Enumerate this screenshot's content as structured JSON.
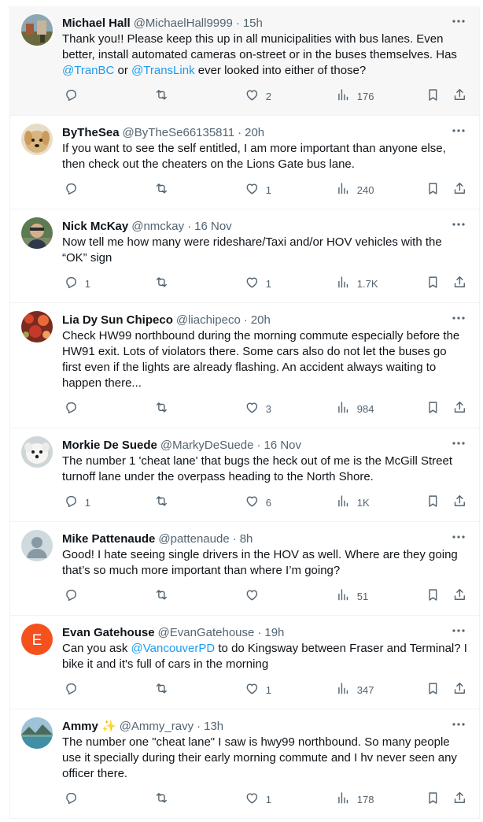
{
  "tweets": [
    {
      "avatar": "scenic-avatar",
      "name": "Michael Hall",
      "handle": "@MichaelHall9999",
      "time": "15h",
      "text_parts": [
        {
          "t": "Thank you!! Please keep this up in all municipalities with bus lanes. Even better, install automated cameras on-street or in the buses themselves. Has ",
          "link": false
        },
        {
          "t": "@TranBC",
          "link": true
        },
        {
          "t": " or ",
          "link": false
        },
        {
          "t": "@TransLink",
          "link": true
        },
        {
          "t": " ever looked into either of those?",
          "link": false
        }
      ],
      "replies": "",
      "retweets": "",
      "likes": "2",
      "views": "176",
      "highlight": true
    },
    {
      "avatar": "dog-avatar",
      "name": "ByTheSea",
      "handle": "@ByTheSe66135811",
      "time": "20h",
      "text_parts": [
        {
          "t": "If you want to see the self entitled, I am more important than anyone else, then check out the cheaters on the Lions Gate bus lane.",
          "link": false
        }
      ],
      "replies": "",
      "retweets": "",
      "likes": "1",
      "views": "240"
    },
    {
      "avatar": "man-avatar",
      "name": "Nick McKay",
      "handle": "@nmckay",
      "time": "16 Nov",
      "text_parts": [
        {
          "t": "Now tell me how many were rideshare/Taxi and/or HOV vehicles with the “OK” sign",
          "link": false
        }
      ],
      "replies": "1",
      "retweets": "",
      "likes": "1",
      "views": "1.7K"
    },
    {
      "avatar": "flowers-avatar",
      "name": "Lia Dy Sun Chipeco",
      "handle": "@liachipeco",
      "time": "20h",
      "text_parts": [
        {
          "t": "Check HW99 northbound during the morning commute especially before the HW91 exit. Lots of violators there. Some cars also do not let the buses go first even if the lights are already flashing. An accident always waiting to happen there...",
          "link": false
        }
      ],
      "replies": "",
      "retweets": "",
      "likes": "3",
      "views": "984"
    },
    {
      "avatar": "white-dog-avatar",
      "name": "Morkie De Suede",
      "handle": "@MarkyDeSuede",
      "time": "16 Nov",
      "text_parts": [
        {
          "t": "The number 1 'cheat lane' that bugs the heck out of me is the McGill Street turnoff lane under the overpass heading to the North Shore.",
          "link": false
        }
      ],
      "replies": "1",
      "retweets": "",
      "likes": "6",
      "views": "1K"
    },
    {
      "avatar": "default-avatar",
      "name": "Mike Pattenaude",
      "handle": "@pattenaude",
      "time": "8h",
      "text_parts": [
        {
          "t": "Good!  I hate seeing single drivers in the HOV as well. Where are they going that’s so much more important than where I’m going?",
          "link": false
        }
      ],
      "replies": "",
      "retweets": "",
      "likes": "",
      "views": "51"
    },
    {
      "avatar": "letter-avatar",
      "avatar_letter": "E",
      "name": "Evan Gatehouse",
      "handle": "@EvanGatehouse",
      "time": "19h",
      "text_parts": [
        {
          "t": "Can you ask ",
          "link": false
        },
        {
          "t": "@VancouverPD",
          "link": true
        },
        {
          "t": " to do Kingsway between Fraser and Terminal? I bike it and it's full of cars in the morning",
          "link": false
        }
      ],
      "replies": "",
      "retweets": "",
      "likes": "1",
      "views": "347"
    },
    {
      "avatar": "lake-avatar",
      "name": "Ammy ✨",
      "handle": "@Ammy_ravy",
      "time": "13h",
      "text_parts": [
        {
          "t": "The number one \"cheat lane\" I saw is hwy99 northbound.  So many people use it specially during their early morning commute and I hv never seen any officer there.",
          "link": false
        }
      ],
      "replies": "",
      "retweets": "",
      "likes": "1",
      "views": "178"
    }
  ],
  "colors": {
    "link": "#1d9bf0",
    "muted": "#536471",
    "text": "#0f1419",
    "divider": "#eff3f4",
    "letter_avatar_bg": "#f4511e"
  },
  "icons": [
    "reply-icon",
    "retweet-icon",
    "like-icon",
    "views-icon",
    "bookmark-icon",
    "share-icon",
    "more-icon"
  ]
}
